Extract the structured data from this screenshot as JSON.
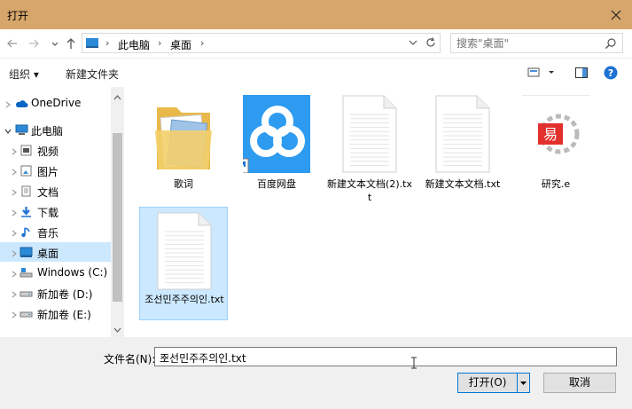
{
  "window": {
    "title": "打开",
    "close_icon": "close-icon"
  },
  "nav": {
    "back_icon": "back-arrow-icon",
    "forward_icon": "forward-arrow-icon",
    "recent_icon": "chevron-down-icon",
    "up_icon": "up-arrow-icon",
    "breadcrumb": [
      "此电脑",
      "桌面"
    ],
    "search_placeholder": "搜索\"桌面\""
  },
  "toolbar": {
    "organize_label": "组织 ▾",
    "new_folder_label": "新建文件夹"
  },
  "sidebar": {
    "items": [
      {
        "label": "OneDrive",
        "icon": "cloud-icon",
        "level": 0,
        "selected": false
      },
      {
        "label": "此电脑",
        "icon": "computer-icon",
        "level": 0,
        "selected": false
      },
      {
        "label": "视频",
        "icon": "video-folder-icon",
        "level": 1,
        "selected": false
      },
      {
        "label": "图片",
        "icon": "pictures-folder-icon",
        "level": 1,
        "selected": false
      },
      {
        "label": "文档",
        "icon": "documents-folder-icon",
        "level": 1,
        "selected": false
      },
      {
        "label": "下载",
        "icon": "download-icon",
        "level": 1,
        "selected": false
      },
      {
        "label": "音乐",
        "icon": "music-icon",
        "level": 1,
        "selected": false
      },
      {
        "label": "桌面",
        "icon": "desktop-icon",
        "level": 1,
        "selected": true
      },
      {
        "label": "Windows (C:)",
        "icon": "drive-c-icon",
        "level": 1,
        "selected": false
      },
      {
        "label": "新加卷 (D:)",
        "icon": "drive-icon",
        "level": 1,
        "selected": false
      },
      {
        "label": "新加卷 (E:)",
        "icon": "drive-icon",
        "level": 1,
        "selected": false
      }
    ]
  },
  "files": [
    {
      "name": "歌词",
      "icon": "folder-icon",
      "selected": false
    },
    {
      "name": "百度网盘",
      "icon": "baidu-netdisk-icon",
      "selected": false
    },
    {
      "name": "新建文本文档(2).txt",
      "icon": "text-file-icon",
      "selected": false
    },
    {
      "name": "新建文本文档.txt",
      "icon": "text-file-icon",
      "selected": false
    },
    {
      "name": "研究.e",
      "icon": "e-language-icon",
      "selected": false
    },
    {
      "name": "조선민주주의인.txt",
      "icon": "text-file-icon",
      "selected": true
    }
  ],
  "bottom": {
    "filename_label": "文件名(N):",
    "filename_value": "조선민주주의인.txt",
    "open_label": "打开(O)",
    "cancel_label": "取消"
  }
}
